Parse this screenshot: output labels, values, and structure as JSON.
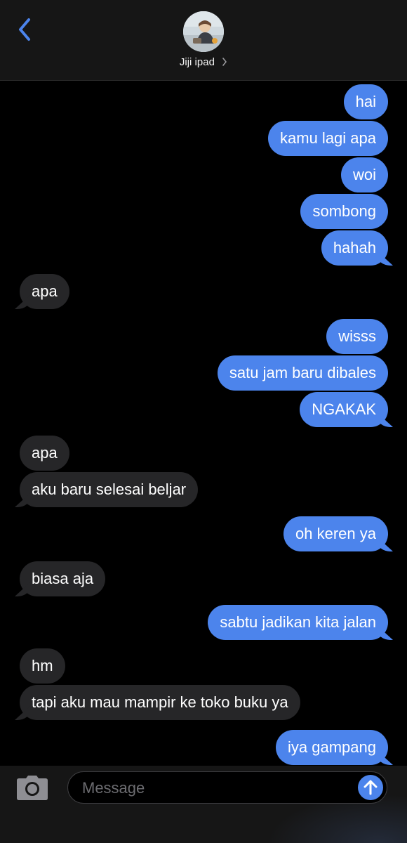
{
  "header": {
    "contact_name": "Jiji ipad",
    "back_icon": "chevron-left-icon",
    "disclosure_icon": "chevron-right-icon"
  },
  "messages": [
    {
      "dir": "out",
      "text": "hai"
    },
    {
      "dir": "out",
      "text": "kamu lagi apa"
    },
    {
      "dir": "out",
      "text": "woi"
    },
    {
      "dir": "out",
      "text": "sombong"
    },
    {
      "dir": "out",
      "text": "hahah"
    },
    {
      "dir": "in",
      "text": "apa"
    },
    {
      "dir": "out",
      "text": "wisss"
    },
    {
      "dir": "out",
      "text": "satu jam baru dibales"
    },
    {
      "dir": "out",
      "text": "NGAKAK"
    },
    {
      "dir": "in",
      "text": "apa"
    },
    {
      "dir": "in",
      "text": "aku baru selesai beljar"
    },
    {
      "dir": "out",
      "text": "oh keren ya"
    },
    {
      "dir": "in",
      "text": "biasa aja"
    },
    {
      "dir": "out",
      "text": "sabtu jadikan kita jalan"
    },
    {
      "dir": "in",
      "text": "hm"
    },
    {
      "dir": "in",
      "text": "tapi aku mau mampir ke toko buku ya"
    },
    {
      "dir": "out",
      "text": "iya gampang"
    }
  ],
  "composer": {
    "placeholder": "Message",
    "camera_icon": "camera-icon",
    "send_icon": "arrow-up-icon"
  },
  "colors": {
    "outgoing_bubble": "#4c84ec",
    "incoming_bubble": "#262628",
    "accent": "#4c84ec"
  }
}
